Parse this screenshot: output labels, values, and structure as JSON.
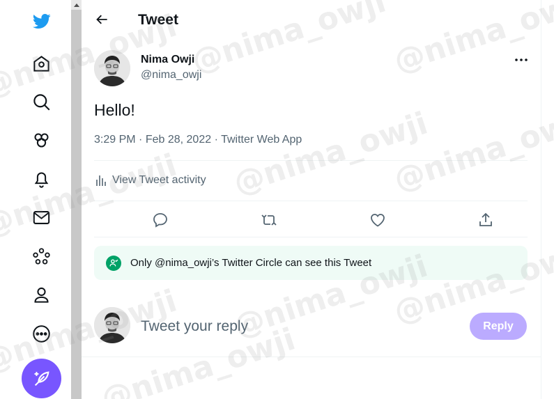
{
  "header": {
    "title": "Tweet"
  },
  "tweet": {
    "author_name": "Nima Owji",
    "author_handle": "@nima_owji",
    "text": "Hello!",
    "time": "3:29 PM",
    "date": "Feb 28, 2022",
    "source": "Twitter Web App",
    "activity_label": "View Tweet activity",
    "circle_notice": "Only @nima_owji’s Twitter Circle can see this Tweet"
  },
  "reply": {
    "placeholder": "Tweet your reply",
    "button_label": "Reply"
  },
  "watermark": "@nima_owji",
  "colors": {
    "twitter_blue": "#1d9bf0",
    "compose_purple": "#7856ff",
    "reply_button": "#bbabff",
    "circle_green": "#00a267",
    "circle_bg": "#effbf6",
    "secondary_text": "#536471"
  },
  "icons": {
    "nav": [
      "twitter-logo-icon",
      "home-icon",
      "explore-icon",
      "communities-icon",
      "notifications-icon",
      "messages-icon",
      "more-circles-icon",
      "profile-icon",
      "more-icon"
    ],
    "actions": [
      "reply-icon",
      "retweet-icon",
      "like-icon",
      "share-icon"
    ]
  }
}
